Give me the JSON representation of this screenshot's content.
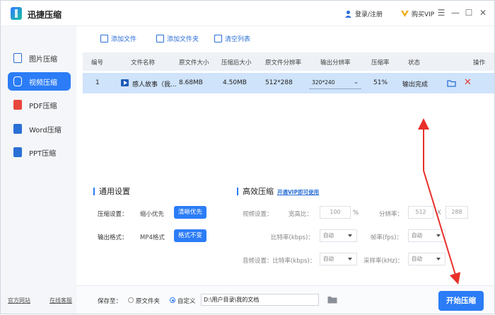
{
  "app": {
    "title": "迅捷压缩",
    "login": "登录/注册",
    "vip": "购买VIP"
  },
  "colors": {
    "accent": "#2b7cf6",
    "row_selected": "#cfe3fb",
    "annotation": "#e8302a",
    "delete": "#e23b3b"
  },
  "sidebar": {
    "items": [
      {
        "label": "图片压缩",
        "icon": "image-icon",
        "active": false
      },
      {
        "label": "视频压缩",
        "icon": "video-icon",
        "active": true
      },
      {
        "label": "PDF压缩",
        "icon": "pdf-icon",
        "active": false
      },
      {
        "label": "Word压缩",
        "icon": "word-icon",
        "active": false
      },
      {
        "label": "PPT压缩",
        "icon": "ppt-icon",
        "active": false
      }
    ],
    "footer_site": "官方网站",
    "footer_service": "在线客服"
  },
  "toolbar": {
    "add_file": "添加文件",
    "add_folder": "添加文件夹",
    "clear_list": "清空列表"
  },
  "table": {
    "headers": [
      "编号",
      "文件名称",
      "原文件大小",
      "压缩后大小",
      "原文件分辨率",
      "输出分辨率",
      "压缩率",
      "状态",
      "操作"
    ],
    "rows": [
      {
        "index": "1",
        "name": "感人故事（我...",
        "orig_size": "8.68MB",
        "comp_size": "4.50MB",
        "orig_res": "512*288",
        "out_res": "320*240",
        "ratio": "51%",
        "status": "输出完成"
      }
    ]
  },
  "general": {
    "title": "通用设置",
    "compress_label": "压缩设置：",
    "compress_opt1": "缩小优先",
    "compress_opt2": "清晰优先",
    "format_label": "输出格式：",
    "format_value": "MP4格式",
    "format_opt": "格式不变"
  },
  "advanced": {
    "title": "高效压缩",
    "vip_link": "开通VIP即可使用",
    "video_label": "视频设置：",
    "width_ratio_label": "宽高比：",
    "width_ratio_value": "100",
    "percent": "%",
    "resolution_label": "分辨率：",
    "res_w": "512",
    "res_x": "X",
    "res_h": "288",
    "bitrate_label": "比特率(kbps)：",
    "bitrate_value": "自动",
    "fps_label": "帧率(fps)：",
    "fps_value": "自动",
    "audio_label": "音频设置：比特率(kbps)：",
    "audio_bitrate_value": "自动",
    "sample_label": "采样率(kHz)：",
    "sample_value": "自动"
  },
  "bottom": {
    "save_to": "保存至：",
    "orig_folder": "原文件夹",
    "custom": "自定义",
    "path": "D:\\用户目录\\我的文档",
    "start": "开始压缩"
  }
}
